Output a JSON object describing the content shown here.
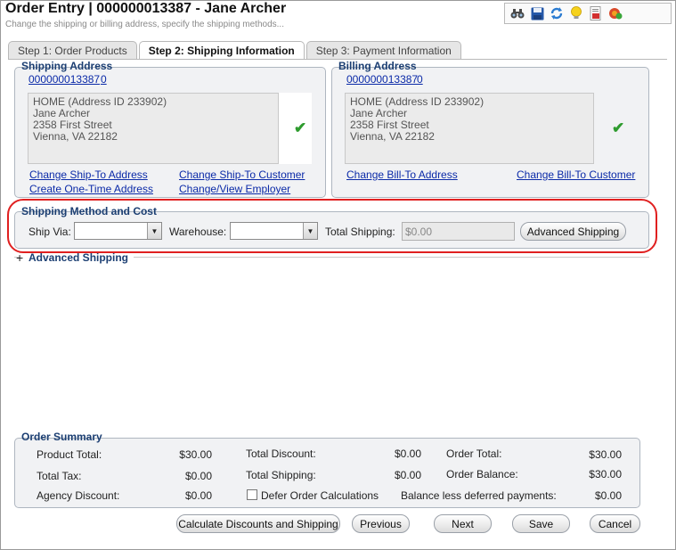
{
  "header": {
    "title": "Order Entry | 000000013387 - Jane Archer",
    "subtitle": "Change the shipping or billing address, specify the shipping methods..."
  },
  "toolbar": {
    "icons": [
      "binoculars-icon",
      "save-icon",
      "refresh-icon",
      "lightbulb-icon",
      "report-icon",
      "cancel-order-icon"
    ]
  },
  "tabs": [
    {
      "label": "Step 1: Order Products",
      "active": false
    },
    {
      "label": "Step 2: Shipping Information",
      "active": true
    },
    {
      "label": "Step 3: Payment Information",
      "active": false
    }
  ],
  "shipping_address": {
    "title": "Shipping Address",
    "customer_id": "000000013387",
    "customer_suffix": "0",
    "address_lines": [
      "HOME (Address ID 233902)",
      "Jane Archer",
      "2358 First Street",
      "Vienna, VA 22182"
    ],
    "links": {
      "change_ship_to_address": "Change Ship-To Address",
      "change_ship_to_customer": "Change Ship-To Customer",
      "create_one_time_address": "Create One-Time Address",
      "change_view_employer": "Change/View Employer"
    }
  },
  "billing_address": {
    "title": "Billing Address",
    "customer_id": "000000013387",
    "customer_suffix": "0",
    "address_lines": [
      "HOME (Address ID 233902)",
      "Jane Archer",
      "2358 First Street",
      "Vienna, VA 22182"
    ],
    "links": {
      "change_bill_to_address": "Change Bill-To Address",
      "change_bill_to_customer": "Change Bill-To Customer"
    }
  },
  "shipping_method": {
    "title": "Shipping Method and Cost",
    "ship_via_label": "Ship Via:",
    "ship_via_value": "",
    "warehouse_label": "Warehouse:",
    "warehouse_value": "",
    "total_shipping_label": "Total Shipping:",
    "total_shipping_value": "$0.00",
    "advanced_button": "Advanced Shipping"
  },
  "advanced_section": {
    "toggle": "+",
    "label": "Advanced Shipping"
  },
  "order_summary": {
    "title": "Order Summary",
    "product_total_label": "Product Total:",
    "product_total": "$30.00",
    "total_tax_label": "Total Tax:",
    "total_tax": "$0.00",
    "agency_discount_label": "Agency Discount:",
    "agency_discount": "$0.00",
    "total_discount_label": "Total Discount:",
    "total_discount": "$0.00",
    "total_shipping_label": "Total Shipping:",
    "total_shipping": "$0.00",
    "defer_label": "Defer Order Calculations",
    "order_total_label": "Order Total:",
    "order_total": "$30.00",
    "order_balance_label": "Order Balance:",
    "order_balance": "$30.00",
    "balance_deferred_label": "Balance less deferred payments:",
    "balance_deferred": "$0.00"
  },
  "footer_buttons": {
    "calculate": "Calculate Discounts and Shipping",
    "previous": "Previous",
    "next": "Next",
    "save": "Save",
    "cancel": "Cancel"
  },
  "colors": {
    "accent_title": "#1b3e72",
    "link": "#0b2aa8",
    "highlight": "#e02020",
    "check": "#2e9b2e"
  }
}
